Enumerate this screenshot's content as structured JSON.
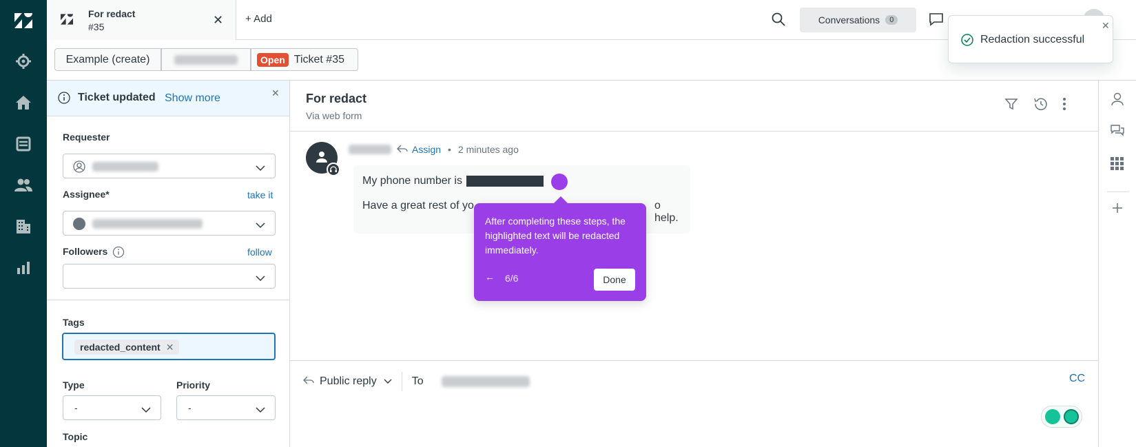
{
  "nav": {
    "items": [
      {
        "icon": "zendesk-logo-icon"
      },
      {
        "icon": "gear-icon"
      },
      {
        "icon": "home-icon"
      },
      {
        "icon": "views-icon"
      },
      {
        "icon": "customers-icon"
      },
      {
        "icon": "organizations-icon"
      },
      {
        "icon": "reporting-icon"
      }
    ]
  },
  "topbar": {
    "tab_title": "For redact",
    "tab_subtitle": "#35",
    "add_label": "Add",
    "conversations_label": "Conversations",
    "conversations_count": "0"
  },
  "toast": {
    "message": "Redaction successful"
  },
  "breadcrumbs": {
    "first": "Example (create)",
    "status": "Open",
    "ticket": "Ticket #35"
  },
  "notice": {
    "title": "Ticket updated",
    "link": "Show more"
  },
  "fields": {
    "requester_label": "Requester",
    "assignee_label": "Assignee*",
    "take_it": "take it",
    "followers_label": "Followers",
    "follow": "follow",
    "tags_label": "Tags",
    "tag_value": "redacted_content",
    "type_label": "Type",
    "type_value": "-",
    "priority_label": "Priority",
    "priority_value": "-",
    "topic_label": "Topic"
  },
  "ticket": {
    "title": "For redact",
    "channel": "Via web form",
    "assign": "Assign",
    "dot": "•",
    "time": "2 minutes ago",
    "line1": "My phone number is",
    "line2_start": "Have a great rest of yo",
    "line2_end": "o help."
  },
  "tooltip": {
    "body": "After completing these steps, the highlighted text will be redacted immediately.",
    "step": "6/6",
    "done": "Done"
  },
  "reply": {
    "mode": "Public reply",
    "to": "To",
    "cc": "CC"
  },
  "colors": {
    "rail": "#03363d",
    "accent": "#1f73b7",
    "tooltip": "#9a3ee8",
    "open_badge": "#e34f32",
    "success": "#038153"
  }
}
